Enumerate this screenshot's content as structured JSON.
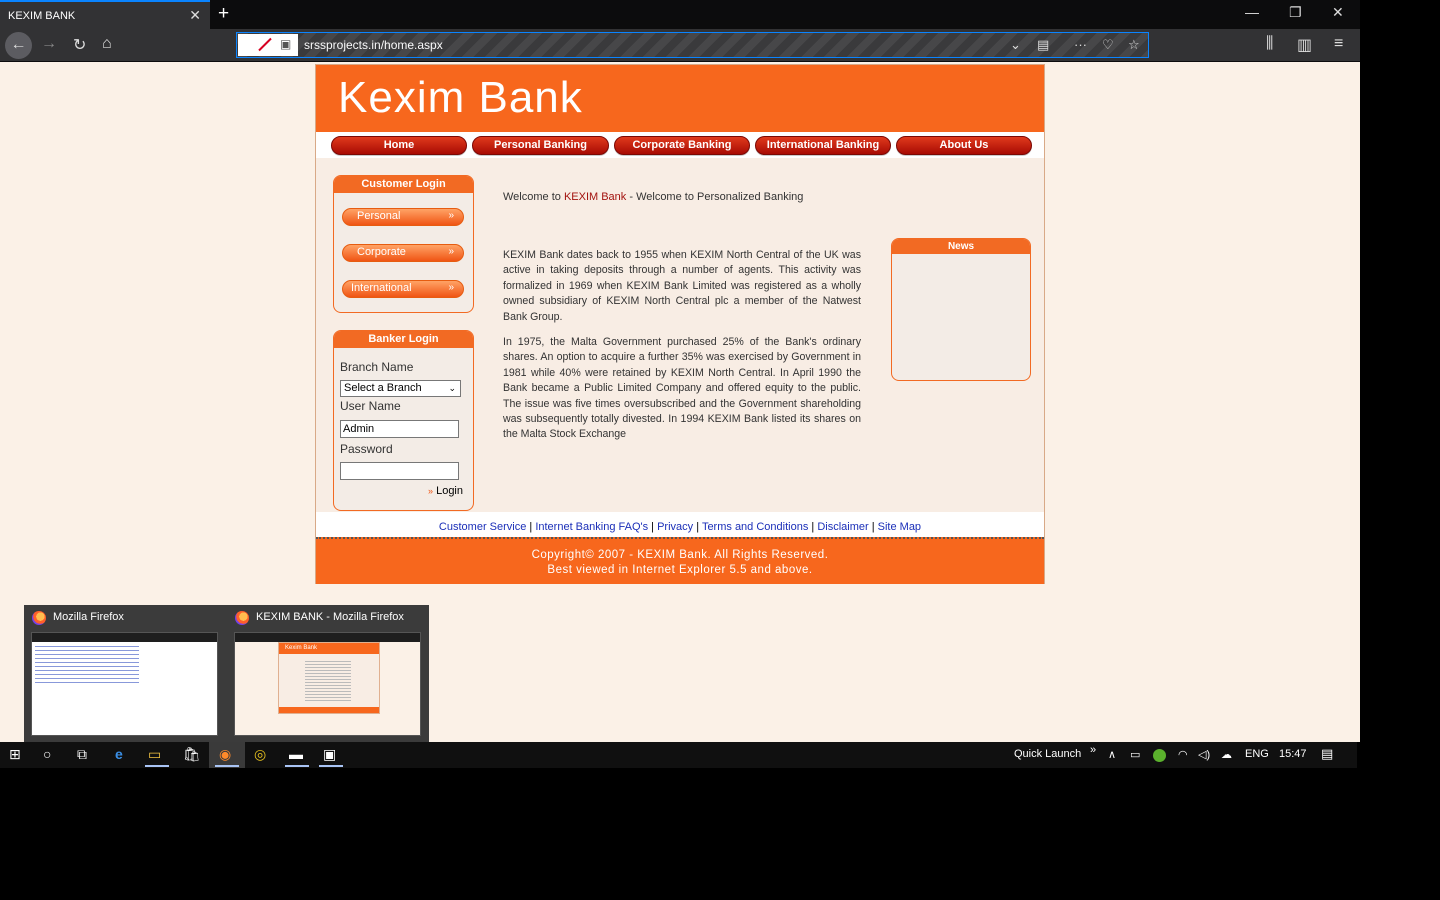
{
  "browser": {
    "tab_title": "KEXIM BANK",
    "tab_close": "✕",
    "new_tab": "+",
    "window_controls": {
      "minimize": "—",
      "restore": "❐",
      "close": "✕"
    },
    "url": "srssprojects.in/home.aspx",
    "nav_icons": {
      "back": "←",
      "forward": "→",
      "reload": "↻",
      "home": "⌂",
      "dropdown": "⌄",
      "reader": "▤",
      "more": "···",
      "pocket": "♡",
      "bookmark": "☆",
      "library": "⫼",
      "sidebar": "▥",
      "menu": "≡"
    }
  },
  "site": {
    "logo": "Kexim Bank",
    "menu": [
      "Home",
      "Personal Banking",
      "Corporate Banking",
      "International Banking",
      "About Us"
    ],
    "customer_login": {
      "title": "Customer Login",
      "buttons": [
        "Personal",
        "Corporate",
        "International"
      ],
      "arrow": "»"
    },
    "banker_login": {
      "title": "Banker Login",
      "branch_label": "Branch Name",
      "branch_value": "Select a Branch",
      "username_label": "User Name",
      "username_value": "Admin",
      "password_label": "Password",
      "password_value": "",
      "login_label": "Login",
      "login_arrow": "»"
    },
    "welcome_prefix": "Welcome to ",
    "welcome_brand": "KEXIM Bank",
    "welcome_suffix": " - Welcome to Personalized Banking",
    "paragraph1": "KEXIM Bank dates back to 1955 when KEXIM North Central of the UK was active in taking deposits through a number of agents. This activity was formalized in 1969 when KEXIM Bank Limited was registered as a wholly owned subsidiary of KEXIM North Central plc a member of the Natwest Bank Group.",
    "paragraph2": "In 1975, the Malta Government purchased 25% of the Bank's ordinary shares. An option to acquire a further 35% was exercised by Government in 1981 while 40% were retained by KEXIM North Central. In April 1990 the Bank became a Public Limited Company and offered equity to the public. The issue was five times oversubscribed and the Government shareholding was subsequently totally divested. In 1994 KEXIM Bank listed its shares on the Malta Stock Exchange",
    "news_title": "News",
    "footer_links": [
      "Customer Service",
      "Internet Banking FAQ's",
      "Privacy",
      "Terms and Conditions",
      "Disclaimer",
      "Site Map"
    ],
    "footer_sep": "|",
    "copyright": "Copyright© 2007 - KEXIM Bank. All Rights Reserved.",
    "best_viewed": "Best viewed in Internet Explorer 5.5 and above."
  },
  "previews": [
    {
      "title": "Mozilla Firefox"
    },
    {
      "title": "KEXIM BANK - Mozilla Firefox",
      "mini_logo": "Kexim Bank"
    }
  ],
  "taskbar": {
    "quick_launch": "Quick Launch",
    "quick_launch_arrow": "»",
    "language": "ENG",
    "time": "15:47",
    "icons": {
      "start": "⊞",
      "search": "○",
      "taskview": "⧉",
      "edge": "e",
      "explorer": "▭",
      "store": "🛍",
      "firefox": "◉",
      "chrome": "◎",
      "app": "▬",
      "cmd": "▣",
      "chevron": "∧",
      "battery": "▭",
      "wifi": "◠",
      "volume": "◁)",
      "cloud": "☁",
      "notify": "▤"
    }
  }
}
